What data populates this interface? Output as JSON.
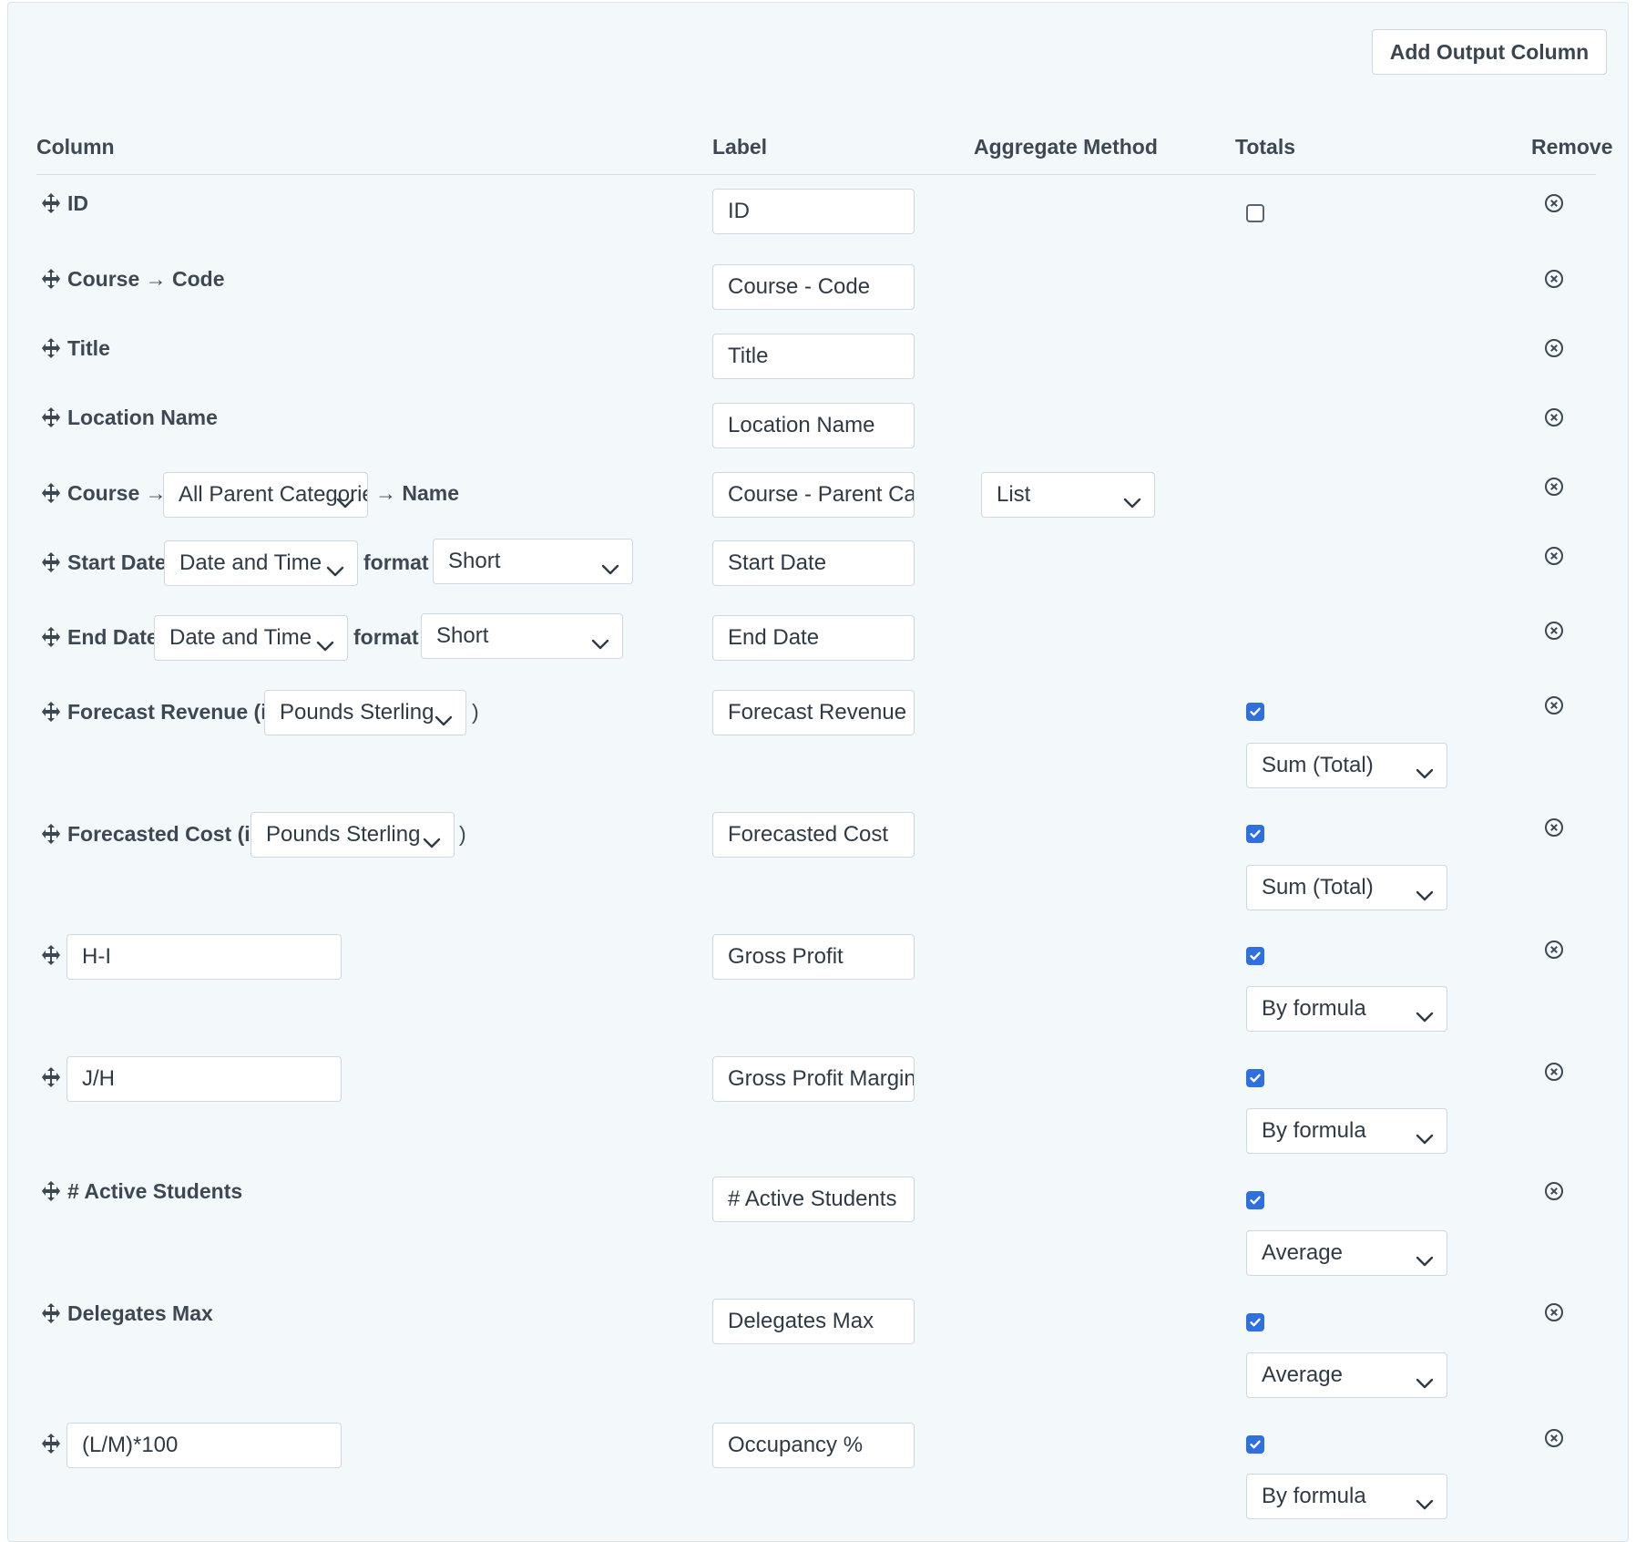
{
  "toolbar": {
    "add_output_column_label": "Add Output Column"
  },
  "headers": {
    "column": "Column",
    "label": "Label",
    "aggregate_method": "Aggregate Method",
    "totals": "Totals",
    "remove": "Remove"
  },
  "rows": [
    {
      "column": "ID",
      "label": "ID",
      "totals_checked": false
    },
    {
      "column": "Course → Code",
      "label": "Course - Code"
    },
    {
      "column": "Title",
      "label": "Title"
    },
    {
      "column": "Location Name",
      "label": "Location Name"
    },
    {
      "column_prefix": "Course →",
      "category_select": "All Parent Categories",
      "column_suffix": "→ Name",
      "label": "Course - Parent Categories",
      "aggregate": "List"
    },
    {
      "column": "Start Date",
      "type_select": "Date and Time",
      "format_word": "format",
      "format_select": "Short",
      "label": "Start Date"
    },
    {
      "column": "End Date",
      "type_select": "Date and Time",
      "format_word": "format",
      "format_select": "Short",
      "label": "End Date"
    },
    {
      "column": "Forecast Revenue (in",
      "currency_select": "Pounds Sterling",
      "close_paren": ")",
      "label": "Forecast Revenue",
      "totals_checked": true,
      "totals_method": "Sum (Total)"
    },
    {
      "column": "Forecasted Cost (in",
      "currency_select": "Pounds Sterling",
      "close_paren": ")",
      "label": "Forecasted Cost",
      "totals_checked": true,
      "totals_method": "Sum (Total)"
    },
    {
      "formula": "H-I",
      "label": "Gross Profit",
      "totals_checked": true,
      "totals_method": "By formula"
    },
    {
      "formula": "J/H",
      "label": "Gross Profit Margin",
      "totals_checked": true,
      "totals_method": "By formula"
    },
    {
      "column": "# Active Students",
      "label": "# Active Students",
      "totals_checked": true,
      "totals_method": "Average"
    },
    {
      "column": "Delegates Max",
      "label": "Delegates Max",
      "totals_checked": true,
      "totals_method": "Average"
    },
    {
      "formula": "(L/M)*100",
      "label": "Occupancy %",
      "totals_checked": true,
      "totals_method": "By formula"
    }
  ],
  "icons": {
    "move": "move-arrows-icon",
    "remove": "remove-circle-icon",
    "dropdown": "chevron-down-icon",
    "check": "checkmark-icon"
  },
  "colors": {
    "checkbox_accent": "#2f6fe0",
    "panel_bg": "#f3f8fb"
  }
}
